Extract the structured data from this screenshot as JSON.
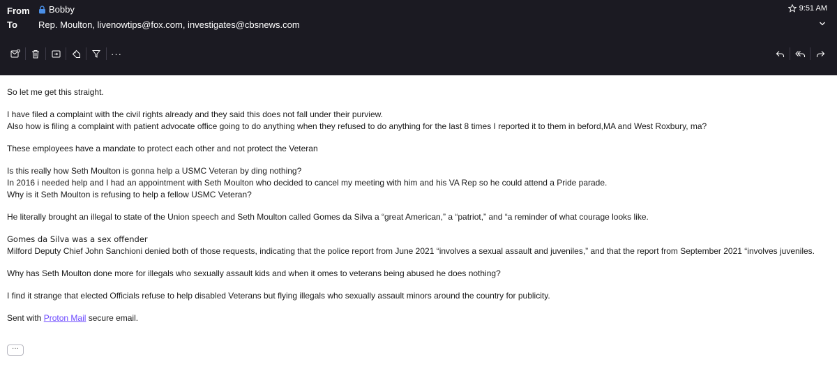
{
  "header": {
    "from_label": "From",
    "to_label": "To",
    "sender_name": "Bobby",
    "recipients": "Rep. Moulton,  livenowtips@fox.com,  investigates@cbsnews.com",
    "time": "9:51 AM",
    "toolbar_more": "···",
    "colors": {
      "background": "#1b1a22",
      "lock": "#4a8fe7",
      "accent": "#6d4aff"
    }
  },
  "toolbar": {
    "left_icons": [
      "mark-unread-icon",
      "trash-icon",
      "move-to-folder-icon",
      "label-tag-icon",
      "filter-icon",
      "more-icon"
    ],
    "right_icons": [
      "reply-icon",
      "reply-all-icon",
      "forward-icon"
    ]
  },
  "message": {
    "p1": "So let me get this straight.",
    "p2_l1": "I have filed a complaint with the civil rights already and they said this does not fall under their purview.",
    "p2_l2": "Also how is filing a complaint with patient advocate office going to do anything when they refused to do anything for the last 8 times I reported it to them in beford,MA and West Roxbury, ma?",
    "p3": "These employees have a mandate to protect each other and not protect the Veteran",
    "p4_l1": "Is this really how Seth Moulton is gonna help a USMC Veteran by ding nothing?",
    "p4_l2": "In 2016 i needed help and I had an appointment with Seth Moulton who decided to cancel my meeting with him and his VA Rep so he could attend a Pride parade.",
    "p4_l3": "Why is it Seth Moulton is refusing to help a fellow USMC Veteran?",
    "p5": "He literally brought an illegal to state of the Union speech and Seth Moulton called Gomes da Silva a “great American,” a “patriot,” and “a reminder of what courage looks like.",
    "p6_l1": "Gomes da Silva was a sex offender",
    "p6_l2": "Milford Deputy Chief John Sanchioni denied both of those requests, indicating that the police report from June 2021 “involves a sexual assault and juveniles,” and that the report from September 2021 “involves juveniles.",
    "p7": "Why has Seth Moulton done more for illegals who sexually assault kids and when it omes to veterans being abused he does nothing?",
    "p8": "I find it strange that elected Officials refuse to help disabled Veterans but flying illegals who sexually assault minors around the country for publicity.",
    "signature_prefix": "Sent with ",
    "signature_link": "Proton Mail",
    "signature_suffix": " secure email.",
    "show_more": "···"
  }
}
